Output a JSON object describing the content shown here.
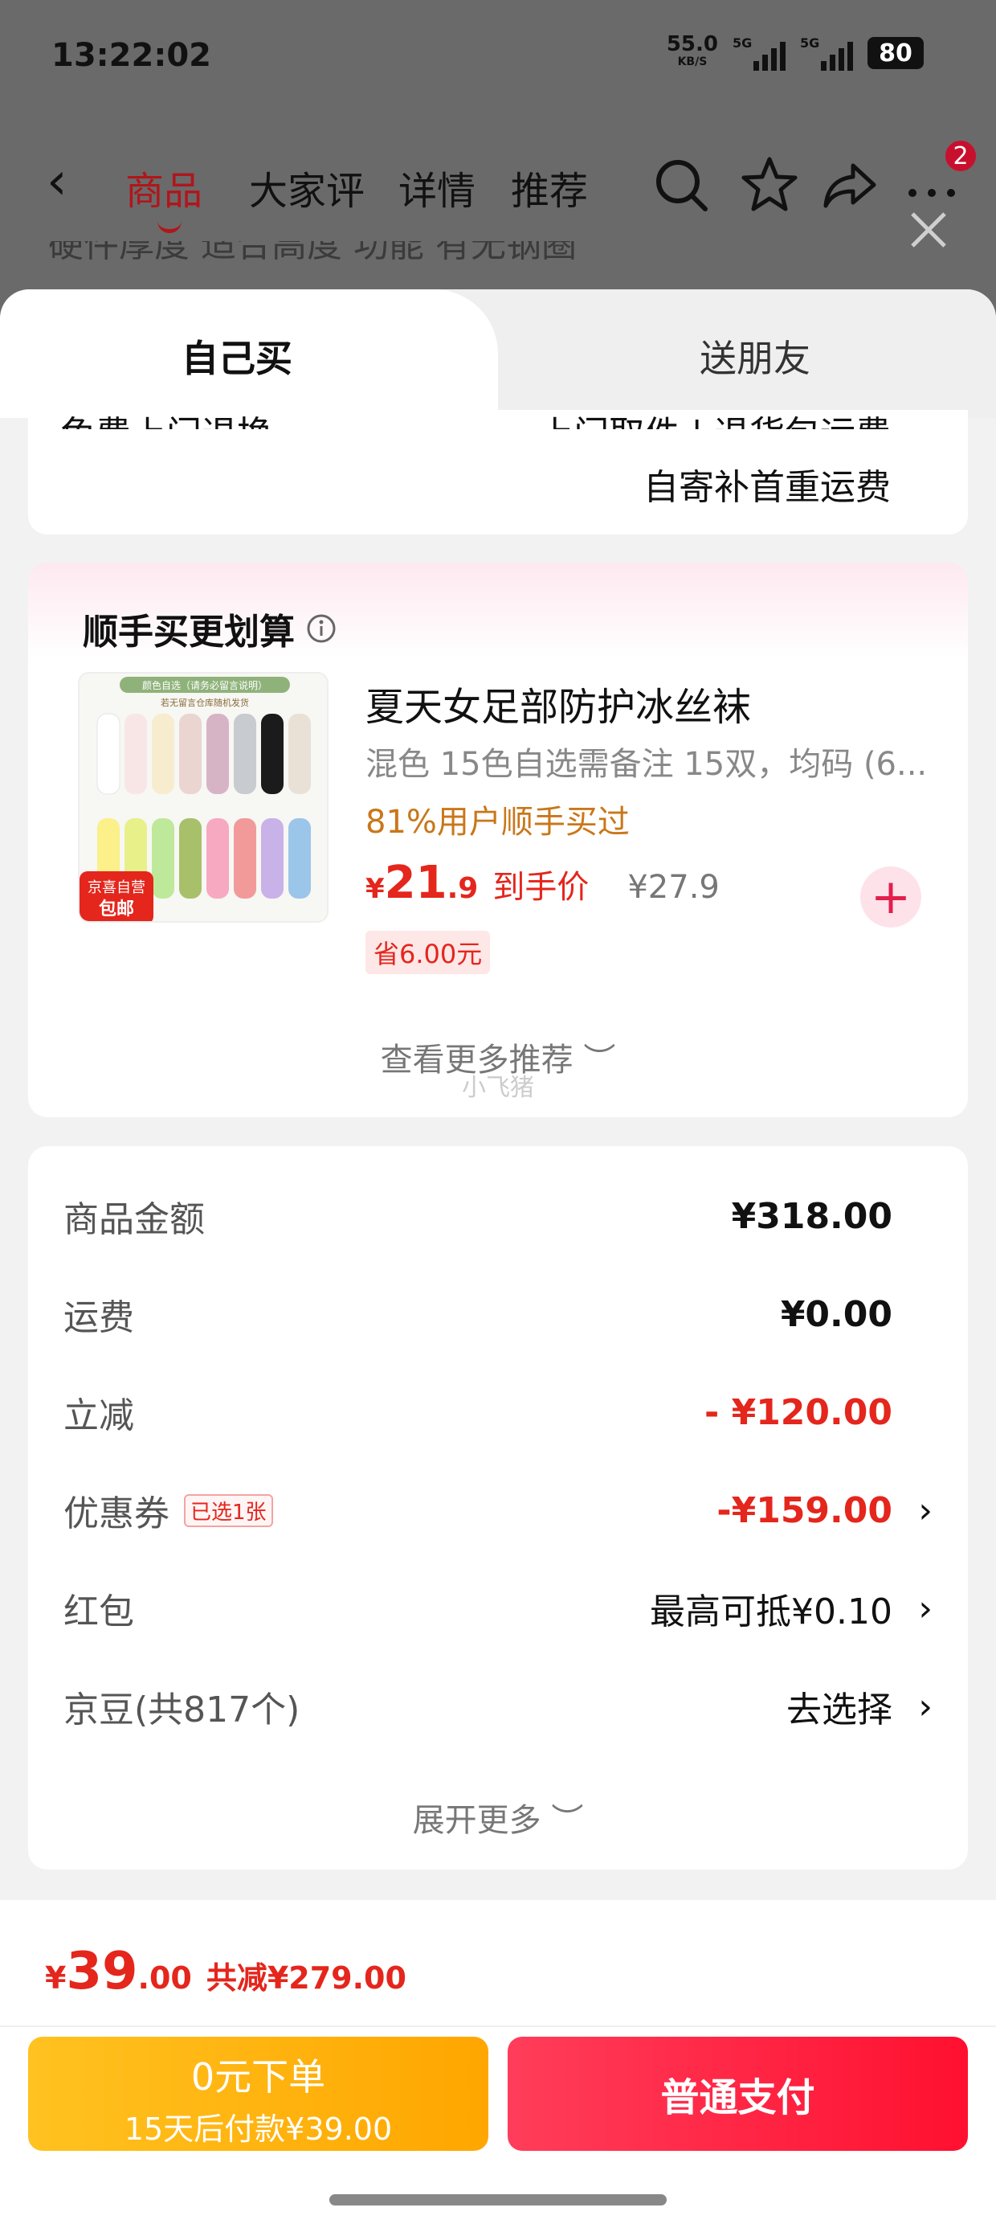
{
  "status": {
    "time": "13:22:02",
    "net_speed": "55.0",
    "net_unit": "KB/S",
    "sig1": "5G",
    "sig2": "5G",
    "battery": "80"
  },
  "nav": {
    "tabs": [
      "商品",
      "大家评",
      "详情",
      "推荐"
    ],
    "badge": "2",
    "bg_spec": "硬件厚度    适合高度    功能    有无钢圈"
  },
  "sheet": {
    "tab_self": "自己买",
    "tab_friend": "送朋友",
    "partial_left": "免费上门退换",
    "partial_right": "上门取件 | 退货包运费",
    "ship_note": "自寄补首重运费"
  },
  "addon": {
    "title": "顺手买更划算",
    "product_name": "夏天女足部防护冰丝袜",
    "product_spec": "混色 15色自选需备注 15双，均码 (6...",
    "stat": "81%用户顺手买过",
    "price_cur": "¥",
    "price_int": "21",
    "price_dec": ".9",
    "price_tag": "到手价",
    "price_orig": "¥27.9",
    "save": "省6.00元",
    "more": "查看更多推荐 ︶",
    "watermark": "小飞猪",
    "img_header": "颜色自选（请务必留言说明）",
    "img_sub": "若无留言仓库随机发货",
    "img_badge1": "京喜自营",
    "img_badge2": "包邮"
  },
  "summary": {
    "rows": [
      {
        "label": "商品金额",
        "value": "¥318.00"
      },
      {
        "label": "运费",
        "value": "¥0.00"
      },
      {
        "label": "立减",
        "value": "- ¥120.00"
      },
      {
        "label": "优惠券",
        "chip": "已选1张",
        "value": "-¥159.00",
        "chev": "›"
      },
      {
        "label": "红包",
        "value": "最高可抵¥0.10",
        "chev": "›"
      },
      {
        "label": "京豆(共817个)",
        "value": "去选择",
        "chev": "›"
      }
    ],
    "expand": "展开更多 ︶"
  },
  "footer": {
    "total_cur": "¥",
    "total_int": "39",
    "total_dec": ".00",
    "total_saved": "共减¥279.00",
    "btn_zero_l1": "0元下单",
    "btn_zero_l2": "15天后付款¥39.00",
    "btn_pay": "普通支付"
  },
  "colors": {
    "accent_red": "#e4261c",
    "brand_red": "#b0161b",
    "pay_btn": "#ff1a3c",
    "zero_btn": "#ffb20f",
    "stat_orange": "#c9771a"
  }
}
